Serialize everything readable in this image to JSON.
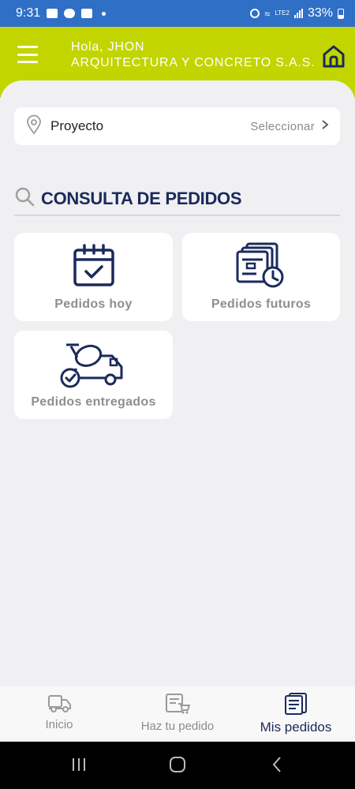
{
  "status_bar": {
    "time": "9:31",
    "battery": "33%",
    "network": "LTE2"
  },
  "header": {
    "greeting": "Hola, JHON",
    "company": "ARQUITECTURA Y CONCRETO S.A.S.",
    "icons": {
      "menu": "hamburger-menu-icon",
      "home": "home-icon"
    }
  },
  "project": {
    "label": "Proyecto",
    "action": "Seleccionar"
  },
  "section": {
    "title": "CONSULTA DE PEDIDOS"
  },
  "tiles": [
    {
      "label": "Pedidos hoy",
      "icon": "calendar-check-icon"
    },
    {
      "label": "Pedidos futuros",
      "icon": "documents-clock-icon"
    },
    {
      "label": "Pedidos entregados",
      "icon": "mixer-truck-check-icon"
    }
  ],
  "bottom_nav": [
    {
      "label": "Inicio",
      "icon": "truck-icon",
      "active": false
    },
    {
      "label": "Haz tu pedido",
      "icon": "form-cart-icon",
      "active": false
    },
    {
      "label": "Mis pedidos",
      "icon": "orders-list-icon",
      "active": true
    }
  ],
  "colors": {
    "brand": "#c2d500",
    "primary": "#1a2a5c",
    "status_bar": "#2f6fc6"
  }
}
